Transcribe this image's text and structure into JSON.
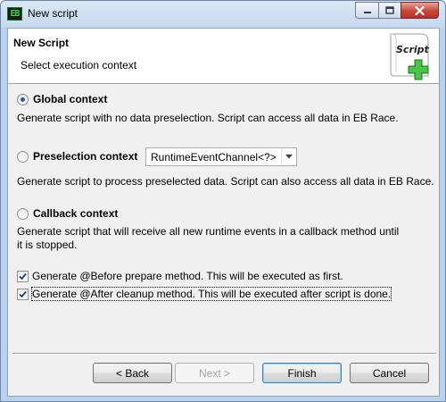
{
  "window": {
    "title": "New script",
    "icon": "eb-app-icon",
    "icon_text": "EB"
  },
  "header": {
    "title": "New Script",
    "subtitle": "Select execution context",
    "image_text": "Script",
    "image_icon": "script-add-icon"
  },
  "contexts": {
    "global": {
      "label": "Global context",
      "selected": true,
      "description": "Generate script with no data preselection. Script can access all data in EB Race."
    },
    "preselection": {
      "label": "Preselection context",
      "selected": false,
      "combo_value": "RuntimeEventChannel<?>",
      "description": "Generate script to process preselected data. Script can also access all data in EB Race."
    },
    "callback": {
      "label": "Callback context",
      "selected": false,
      "description_line1": "Generate script that will receive all new runtime events in a callback method until",
      "description_line2": "it is stopped."
    }
  },
  "options": {
    "before": {
      "label": "Generate @Before prepare method. This will be executed as first.",
      "checked": true
    },
    "after": {
      "label": "Generate @After cleanup method. This will be executed after script is done.",
      "checked": true
    }
  },
  "buttons": {
    "back": "< Back",
    "next": "Next >",
    "finish": "Finish",
    "cancel": "Cancel"
  },
  "colors": {
    "accent": "#1f58b6",
    "plus_green": "#3cb43c"
  }
}
